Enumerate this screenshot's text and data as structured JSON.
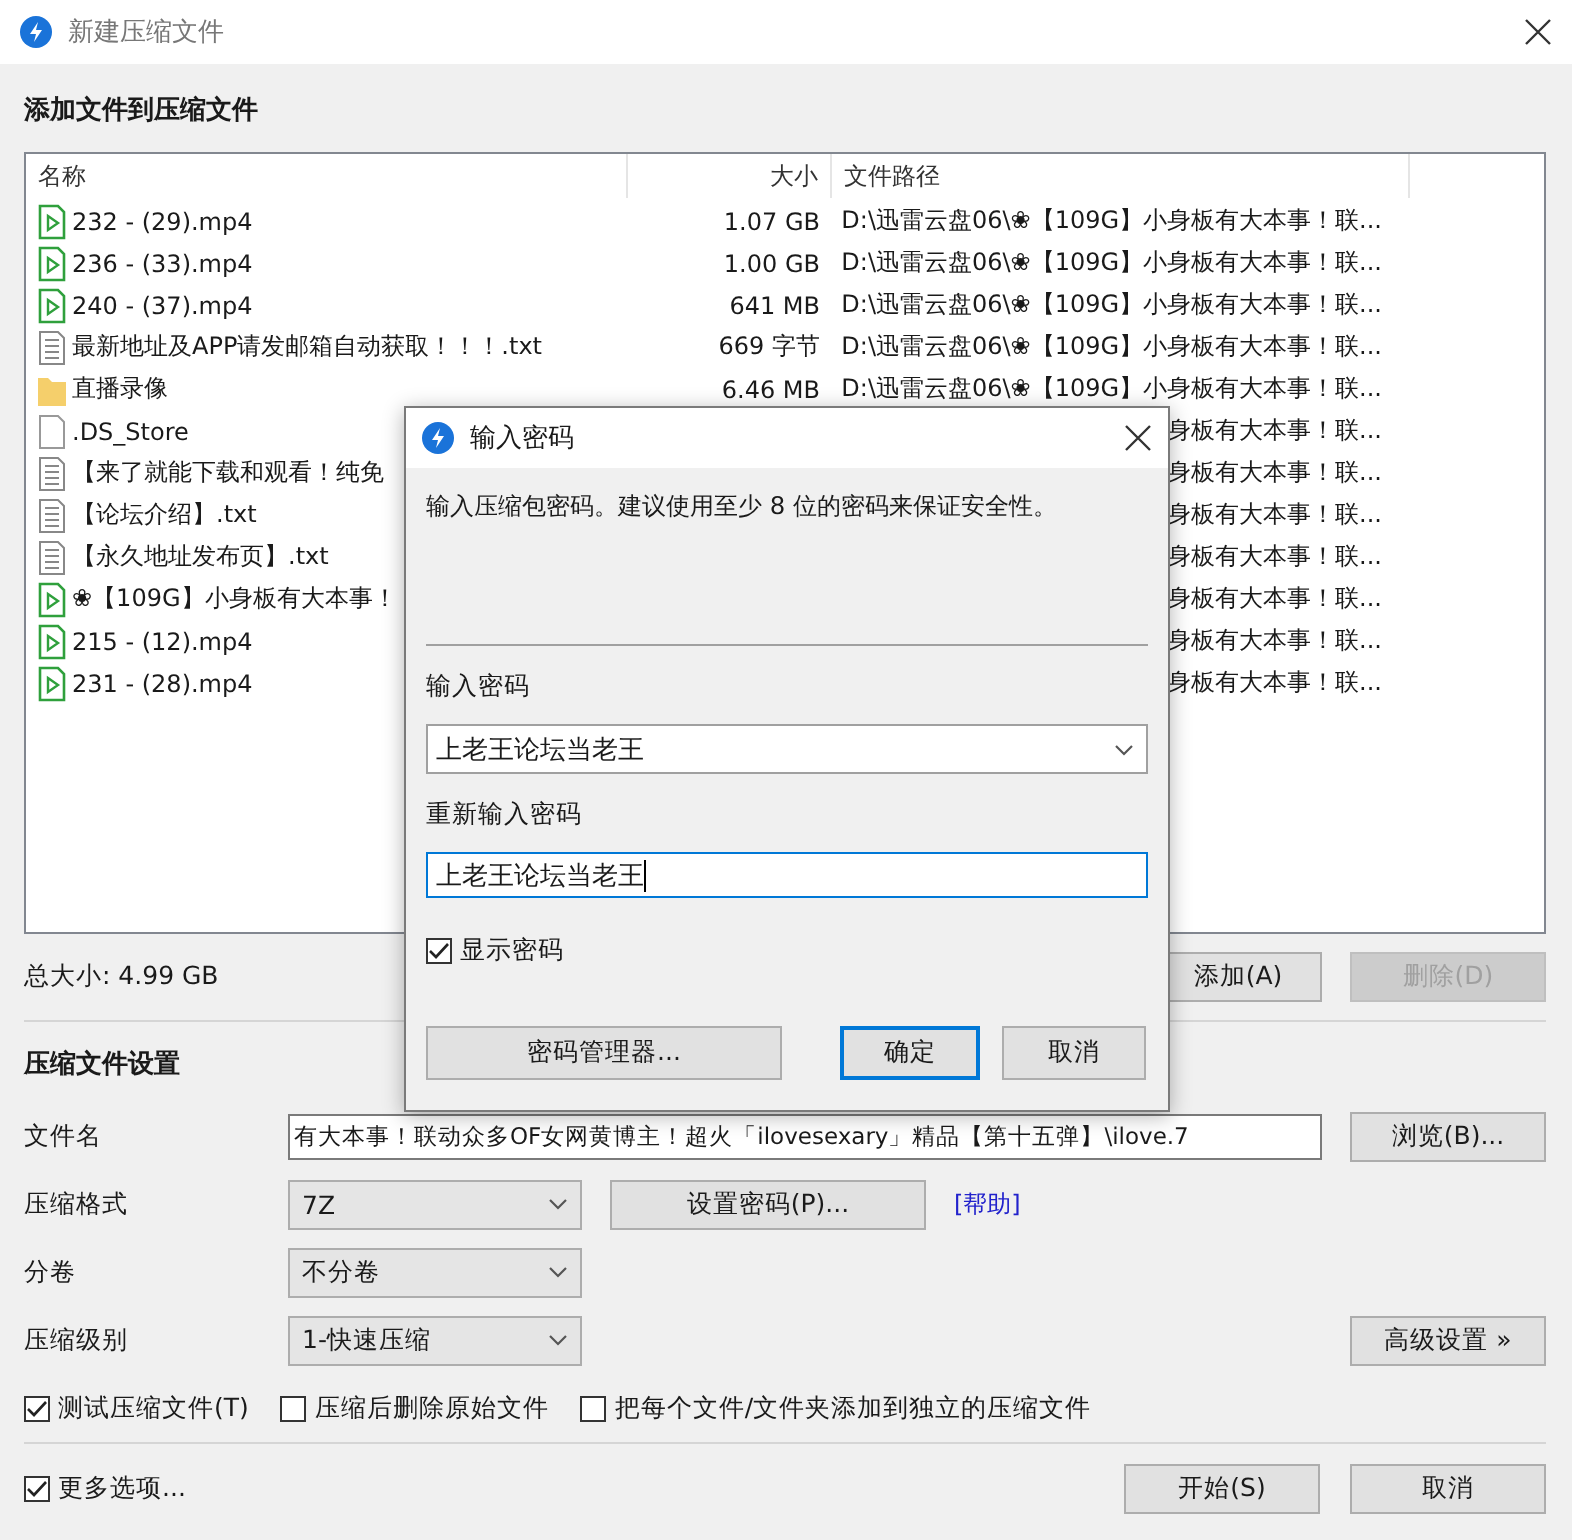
{
  "window": {
    "title": "新建压缩文件"
  },
  "files": {
    "title": "添加文件到压缩文件",
    "columns": [
      "名称",
      "大小",
      "文件路径"
    ],
    "rows": [
      {
        "kind": "video",
        "name": "232 - (29).mp4",
        "size": "1.07 GB",
        "path": "D:\\迅雷云盘06\\❀【109G】小身板有大本事！联..."
      },
      {
        "kind": "video",
        "name": "236 - (33).mp4",
        "size": "1.00 GB",
        "path": "D:\\迅雷云盘06\\❀【109G】小身板有大本事！联..."
      },
      {
        "kind": "video",
        "name": "240 - (37).mp4",
        "size": "641 MB",
        "path": "D:\\迅雷云盘06\\❀【109G】小身板有大本事！联..."
      },
      {
        "kind": "text",
        "name": "最新地址及APP请发邮箱自动获取！！！.txt",
        "size": "669 字节",
        "path": "D:\\迅雷云盘06\\❀【109G】小身板有大本事！联..."
      },
      {
        "kind": "folder",
        "name": "直播录像",
        "size": "6.46 MB",
        "path": "D:\\迅雷云盘06\\❀【109G】小身板有大本事！联..."
      },
      {
        "kind": "file",
        "name": ".DS_Store",
        "path": "身板有大本事！联..."
      },
      {
        "kind": "text",
        "name": "【来了就能下载和观看！纯免",
        "path": "身板有大本事！联..."
      },
      {
        "kind": "text",
        "name": "【论坛介绍】.txt",
        "path": "身板有大本事！联..."
      },
      {
        "kind": "text",
        "name": "【永久地址发布页】.txt",
        "path": "身板有大本事！联..."
      },
      {
        "kind": "video",
        "name": "❀【109G】小身板有大本事！",
        "path": "身板有大本事！联..."
      },
      {
        "kind": "video",
        "name": "215 - (12).mp4",
        "path": "身板有大本事！联..."
      },
      {
        "kind": "video",
        "name": "231 - (28).mp4",
        "path": "身板有大本事！联..."
      }
    ]
  },
  "total": "总大小: 4.99 GB",
  "list_buttons": [
    {
      "label": "添加(A)",
      "disabled": false
    },
    {
      "label": "删除(D)",
      "disabled": true
    }
  ],
  "settings": {
    "title": "压缩文件设置",
    "rows": [
      {
        "label": "文件名",
        "kind": "text",
        "value": "有大本事！联动众多OF女网黄博主！超火「ilovesexary」精品【第十五弹】\\ilove.7",
        "button": {
          "label": "浏览(B)...",
          "kind": "side"
        }
      },
      {
        "label": "压缩格式",
        "kind": "select",
        "value": "7Z",
        "button": {
          "label": "设置密码(P)...",
          "kind": "inline"
        },
        "link": "[帮助]"
      },
      {
        "label": "分卷",
        "kind": "select",
        "value": "不分卷"
      },
      {
        "label": "压缩级别",
        "kind": "select",
        "value": "1-快速压缩",
        "button": {
          "label": "高级设置 »",
          "kind": "side"
        }
      }
    ],
    "checkboxes": [
      {
        "label": "测试压缩文件(T)",
        "checked": true
      },
      {
        "label": "压缩后删除原始文件",
        "checked": false
      },
      {
        "label": "把每个文件/文件夹添加到独立的压缩文件",
        "checked": false
      }
    ]
  },
  "footer": {
    "more_options": {
      "label": "更多选项...",
      "checked": true
    },
    "buttons": [
      {
        "label": "开始(S)",
        "disabled": false
      },
      {
        "label": "取消",
        "disabled": false
      }
    ]
  },
  "dialog": {
    "title": "输入密码",
    "message": "输入压缩包密码。建议使用至少 8 位的密码来保证安全性。",
    "password_label": "输入密码",
    "password_value": "上老王论坛当老王",
    "confirm_label": "重新输入密码",
    "confirm_value": "上老王论坛当老王",
    "confirm_focused": true,
    "show_password": {
      "label": "显示密码",
      "checked": true
    },
    "buttons": [
      {
        "label": "密码管理器...",
        "default": false
      },
      {
        "label": "确定",
        "default": true
      },
      {
        "label": "取消",
        "default": false
      }
    ]
  }
}
